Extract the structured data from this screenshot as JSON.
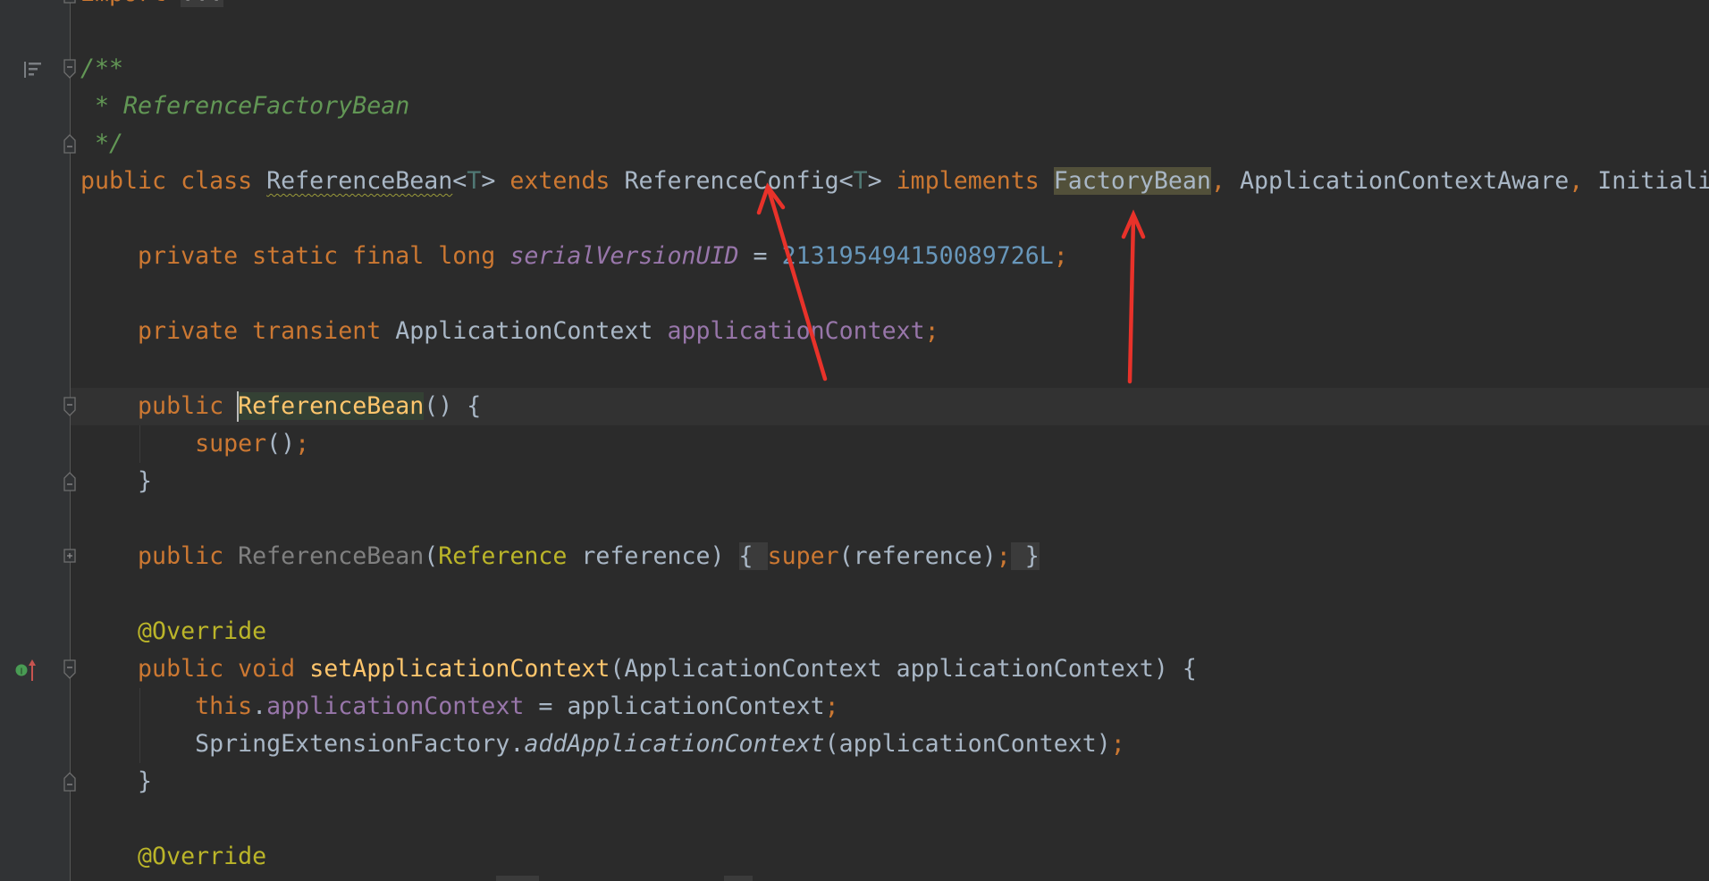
{
  "editor": {
    "first_line_number": 16,
    "current_line_index": 11,
    "colors": {
      "background": "#2b2b2b",
      "gutter": "#313335",
      "keyword": "#cc7832",
      "doc_comment": "#629755",
      "number": "#6897bb",
      "field": "#9876aa",
      "annotation": "#bbb529",
      "method_declaration": "#ffc66d",
      "annotation_arrow": "#e8322a"
    },
    "gutter_icons": [
      {
        "line_index": 2,
        "icon": "render-doc-icon"
      },
      {
        "line_index": 18,
        "icon": "implements-method-icon",
        "label": "I"
      }
    ],
    "lines": [
      [
        {
          "t": "import ",
          "c": "kw"
        },
        {
          "t": "...",
          "c": "gray fold"
        }
      ],
      [],
      [
        {
          "t": "/**",
          "c": "doc"
        }
      ],
      [
        {
          "t": " * ReferenceFactoryBean",
          "c": "doc"
        }
      ],
      [
        {
          "t": " */",
          "c": "doc"
        }
      ],
      [
        {
          "t": "public class ",
          "c": "kw"
        },
        {
          "t": "ReferenceBean",
          "c": "txt wavy"
        },
        {
          "t": "<",
          "c": "txt"
        },
        {
          "t": "T",
          "c": "tp"
        },
        {
          "t": "> ",
          "c": "txt"
        },
        {
          "t": "extends ",
          "c": "kw"
        },
        {
          "t": "ReferenceConfig<",
          "c": "txt"
        },
        {
          "t": "T",
          "c": "tp"
        },
        {
          "t": "> ",
          "c": "txt"
        },
        {
          "t": "implements ",
          "c": "kw"
        },
        {
          "t": "FactoryBean",
          "c": "txt hl"
        },
        {
          "t": ", ",
          "c": "kw"
        },
        {
          "t": "ApplicationContextAware",
          "c": "txt"
        },
        {
          "t": ", ",
          "c": "kw"
        },
        {
          "t": "Initiali",
          "c": "txt"
        }
      ],
      [],
      [
        {
          "t": "    private static final long ",
          "c": "kw"
        },
        {
          "t": "serialVersionUID",
          "c": "fld ital"
        },
        {
          "t": " = ",
          "c": "txt"
        },
        {
          "t": "213195494150089726L",
          "c": "num"
        },
        {
          "t": ";",
          "c": "kw"
        }
      ],
      [],
      [
        {
          "t": "    private transient ",
          "c": "kw"
        },
        {
          "t": "ApplicationContext ",
          "c": "txt"
        },
        {
          "t": "applicationContext",
          "c": "fld"
        },
        {
          "t": ";",
          "c": "kw"
        }
      ],
      [],
      [
        {
          "t": "    public ",
          "c": "kw"
        },
        {
          "t": "ReferenceBean",
          "c": "mdecl hlg"
        },
        {
          "t": "() {",
          "c": "txt"
        }
      ],
      [
        {
          "t": "        super",
          "c": "kw"
        },
        {
          "t": "()",
          "c": "txt"
        },
        {
          "t": ";",
          "c": "kw"
        }
      ],
      [
        {
          "t": "    }",
          "c": "txt"
        }
      ],
      [],
      [
        {
          "t": "    public ",
          "c": "kw"
        },
        {
          "t": "ReferenceBean",
          "c": "gray"
        },
        {
          "t": "(",
          "c": "txt"
        },
        {
          "t": "Reference",
          "c": "annref"
        },
        {
          "t": " reference) ",
          "c": "txt"
        },
        {
          "t": "{ ",
          "c": "txt fold"
        },
        {
          "t": "super",
          "c": "kw"
        },
        {
          "t": "(reference)",
          "c": "txt"
        },
        {
          "t": ";",
          "c": "kw"
        },
        {
          "t": " }",
          "c": "txt fold"
        }
      ],
      [],
      [
        {
          "t": "    @Override",
          "c": "ann"
        }
      ],
      [
        {
          "t": "    public void ",
          "c": "kw"
        },
        {
          "t": "setApplicationContext",
          "c": "mdecl"
        },
        {
          "t": "(ApplicationContext applicationContext) {",
          "c": "txt"
        }
      ],
      [
        {
          "t": "        this",
          "c": "kw"
        },
        {
          "t": ".",
          "c": "txt"
        },
        {
          "t": "applicationContext",
          "c": "fld"
        },
        {
          "t": " = applicationContext",
          "c": "txt"
        },
        {
          "t": ";",
          "c": "kw"
        }
      ],
      [
        {
          "t": "        SpringExtensionFactory.",
          "c": "txt"
        },
        {
          "t": "addApplicationContext",
          "c": "txt ital"
        },
        {
          "t": "(applicationContext)",
          "c": "txt"
        },
        {
          "t": ";",
          "c": "kw"
        }
      ],
      [
        {
          "t": "    }",
          "c": "txt"
        }
      ],
      [],
      [
        {
          "t": "    @Override",
          "c": "ann"
        }
      ]
    ]
  }
}
